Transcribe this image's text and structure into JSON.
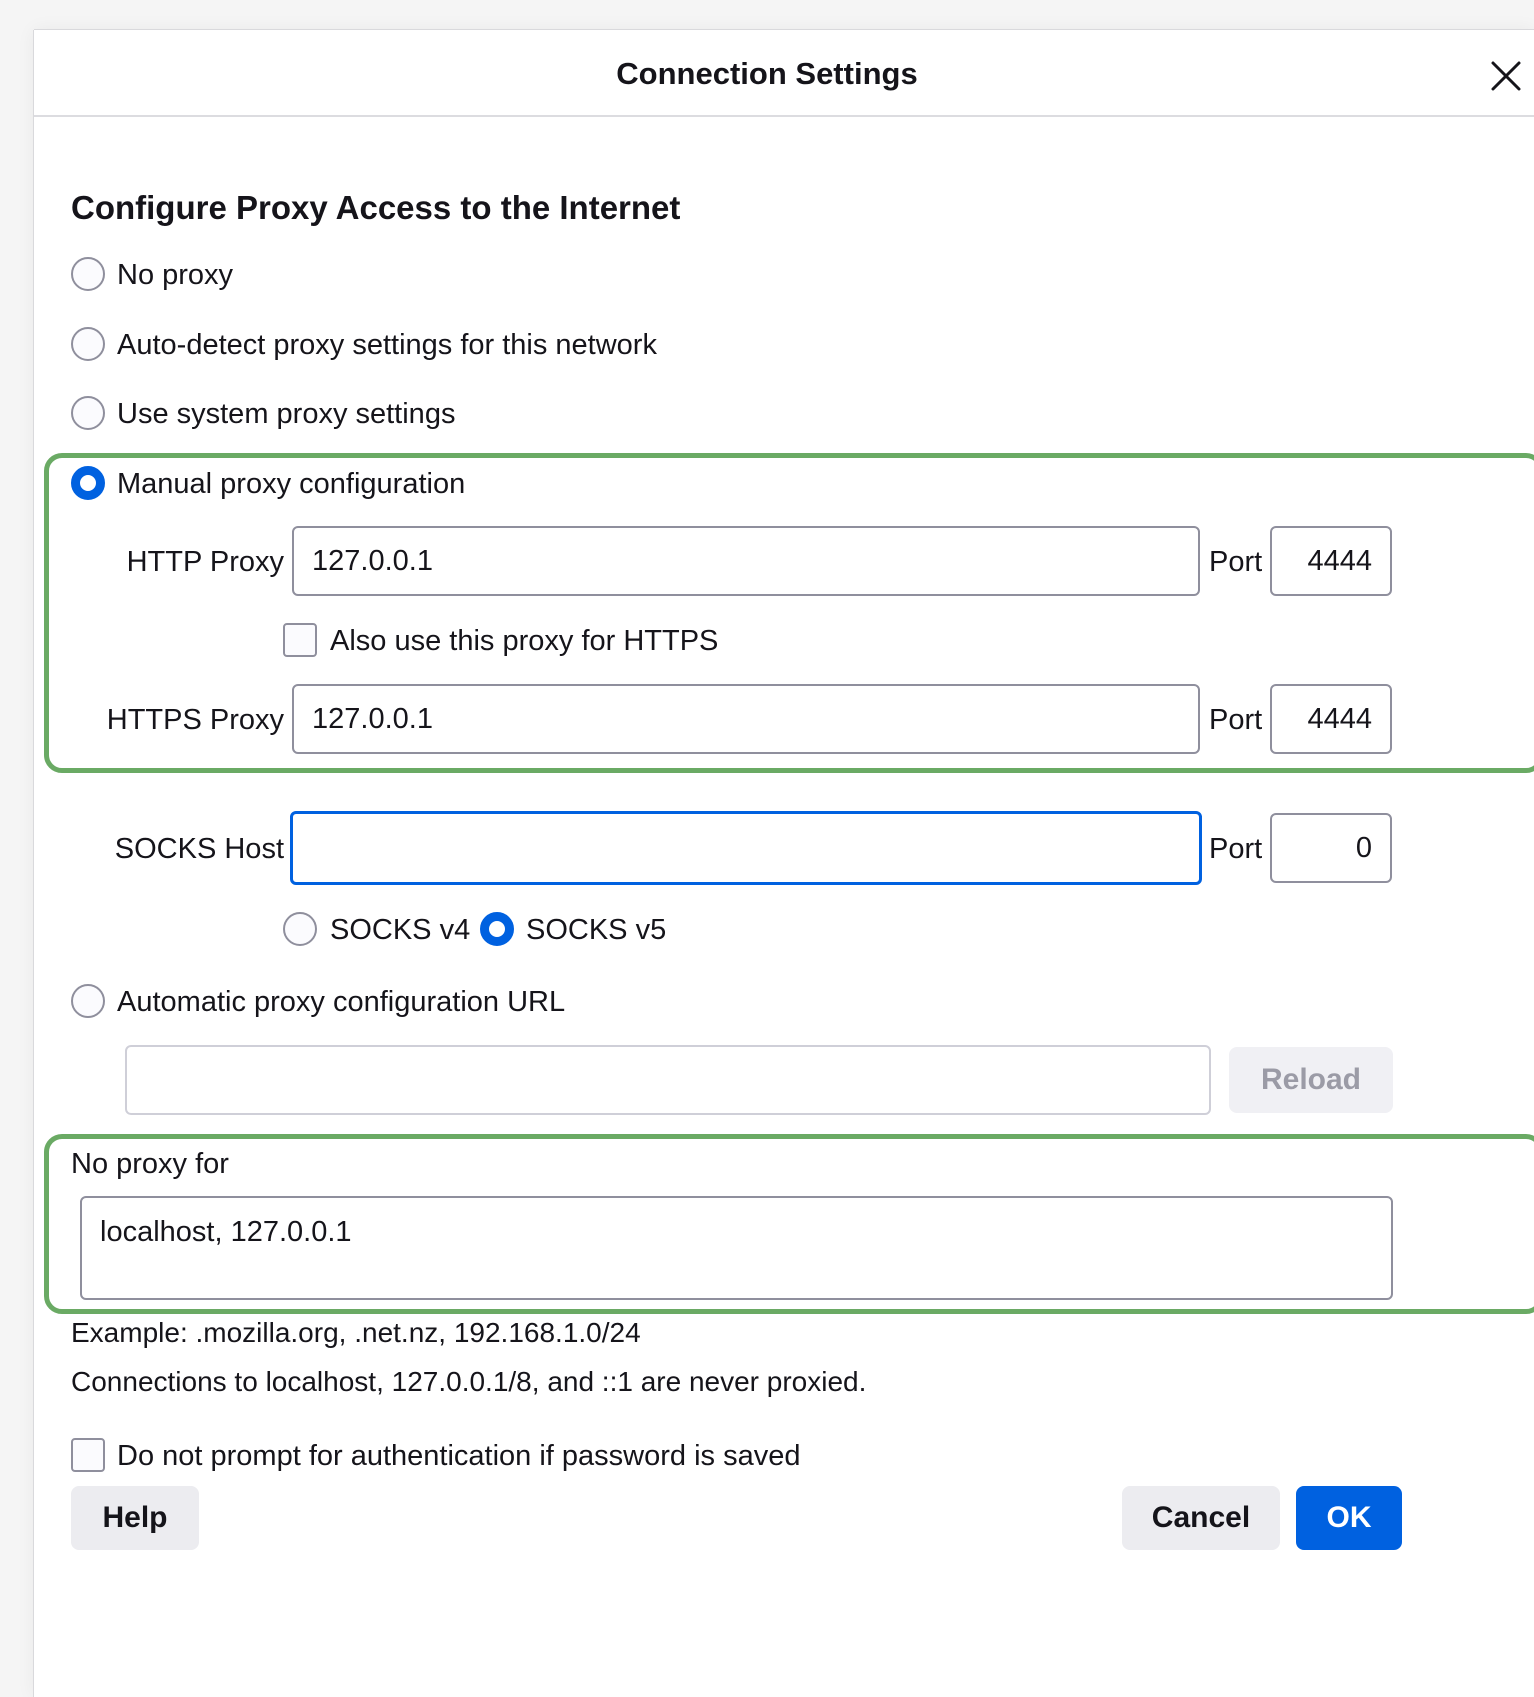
{
  "dialog": {
    "title": "Connection Settings",
    "close_icon": "close-icon"
  },
  "section": {
    "heading": "Configure Proxy Access to the Internet"
  },
  "proxy_modes": {
    "no_proxy": "No proxy",
    "auto_detect": "Auto-detect proxy settings for this network",
    "system": "Use system proxy settings",
    "manual": "Manual proxy configuration",
    "auto_url": "Automatic proxy configuration URL",
    "selected": "manual"
  },
  "manual": {
    "http_label": "HTTP Proxy",
    "http_value": "127.0.0.1",
    "http_port_label": "Port",
    "http_port": "4444",
    "also_https_label": "Also use this proxy for HTTPS",
    "also_https_checked": false,
    "https_label": "HTTPS Proxy",
    "https_value": "127.0.0.1",
    "https_port_label": "Port",
    "https_port": "4444",
    "socks_label": "SOCKS Host",
    "socks_value": "",
    "socks_port_label": "Port",
    "socks_port": "0",
    "socks_v4": "SOCKS v4",
    "socks_v5": "SOCKS v5",
    "socks_selected": "v5"
  },
  "auto_config": {
    "url_value": "",
    "reload_label": "Reload"
  },
  "no_proxy_for": {
    "label": "No proxy for",
    "value": "localhost, 127.0.0.1",
    "example": "Example: .mozilla.org, .net.nz, 192.168.1.0/24",
    "note": "Connections to localhost, 127.0.0.1/8, and ::1 are never proxied."
  },
  "auth": {
    "label": "Do not prompt for authentication if password is saved",
    "checked": false
  },
  "footer": {
    "help": "Help",
    "cancel": "Cancel",
    "ok": "OK"
  },
  "colors": {
    "accent": "#0061e0",
    "highlight": "#6aaa64"
  }
}
